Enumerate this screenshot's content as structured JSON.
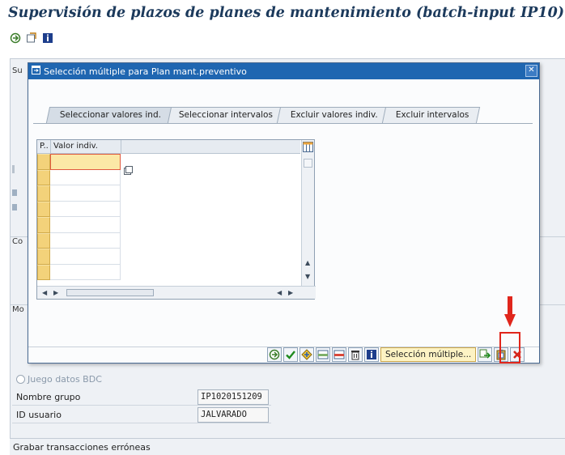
{
  "window": {
    "title": "Supervisión de plazos de planes de mantenimiento (batch-input IP10)"
  },
  "toolbar": {
    "icons": [
      "execute-icon",
      "variant-icon",
      "info-icon"
    ]
  },
  "background": {
    "group_stubs": [
      "Su",
      "Co",
      "Mo"
    ],
    "bdc_radio_label": "Juego datos BDC",
    "group_name_label": "Nombre grupo",
    "group_name_value": "IP1020151209",
    "user_id_label": "ID usuario",
    "user_id_value": "JALVARADO",
    "footer_group_label": "Grabar transacciones erróneas"
  },
  "dialog": {
    "title": "Selección múltiple para Plan mant.preventivo",
    "tabs": [
      "Seleccionar valores ind.",
      "Seleccionar intervalos",
      "Excluir valores indiv.",
      "Excluir intervalos"
    ],
    "active_tab_index": 0,
    "grid": {
      "columns": [
        "P..",
        "Valor indiv."
      ],
      "row_count": 9,
      "values": [
        "",
        "",
        "",
        "",
        "",
        "",
        "",
        "",
        ""
      ]
    },
    "multi_select_button": "Selección múltiple...",
    "footer_icons": [
      "execute-icon",
      "check-icon",
      "multi-icon",
      "insert-row-icon",
      "delete-row-icon",
      "trash-icon",
      "info-icon",
      "import-text-icon",
      "upload-clipboard-icon",
      "cancel-icon"
    ]
  },
  "annotation": {
    "color": "#e0261c",
    "target": "upload-clipboard-icon"
  }
}
